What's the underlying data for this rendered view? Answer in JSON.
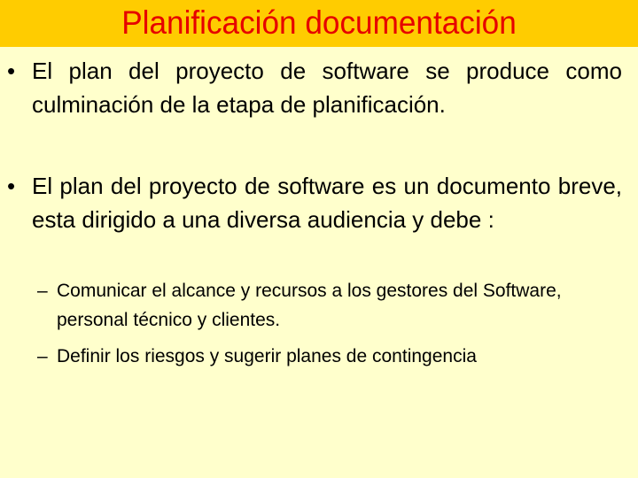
{
  "slide": {
    "title": "Planificación documentación",
    "bullets": [
      {
        "marker": "•",
        "text": "El plan del proyecto de software se produce como culminación de la etapa de planificación."
      },
      {
        "marker": "•",
        "text": "El plan del proyecto de software es un documento breve, esta dirigido a una diversa audiencia y debe :",
        "sub_bullets": [
          {
            "marker": "–",
            "text": "Comunicar el alcance y recursos a los gestores del Software, personal técnico y clientes."
          },
          {
            "marker": "–",
            "text": "Definir los riesgos y sugerir planes de contingencia"
          }
        ]
      }
    ]
  },
  "colors": {
    "title_bar": "#FFCC00",
    "title_text": "#E60000",
    "background": "#FFFFCC",
    "body_text": "#000000"
  }
}
